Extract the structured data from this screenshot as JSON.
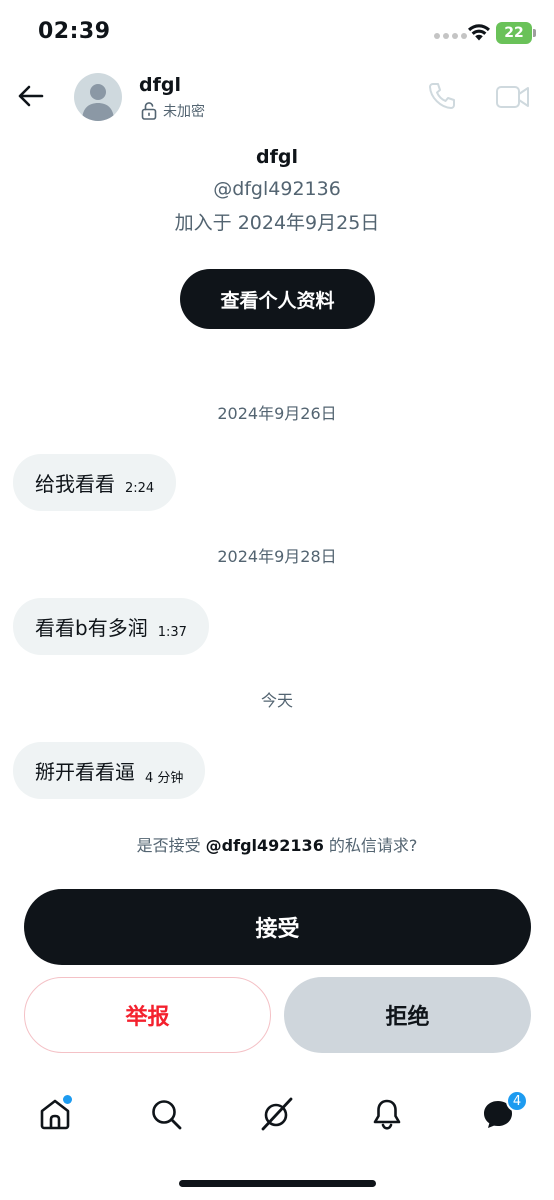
{
  "status_bar": {
    "time": "02:39",
    "battery": "22"
  },
  "header": {
    "name": "dfgl",
    "encryption": "未加密",
    "icons": {
      "back": "arrow-left-icon",
      "lock": "unlock-icon",
      "call": "phone-icon",
      "video": "video-icon"
    }
  },
  "profile": {
    "name": "dfgl",
    "handle": "@dfgl492136",
    "joined": "加入于 2024年9月25日",
    "view_profile_label": "查看个人资料"
  },
  "messages": [
    {
      "date": "2024年9月26日",
      "text": "给我看看",
      "time": "2:24"
    },
    {
      "date": "2024年9月28日",
      "text": "看看b有多润",
      "time": "1:37"
    },
    {
      "date": "今天",
      "text": "掰开看看逼",
      "time": "4 分钟"
    }
  ],
  "request": {
    "prefix": "是否接受 ",
    "handle": "@dfgl492136",
    "suffix": " 的私信请求?",
    "accept_label": "接受",
    "report_label": "举报",
    "decline_label": "拒绝"
  },
  "nav": {
    "messages_badge": "4",
    "icons": [
      "home-icon",
      "search-icon",
      "grok-icon",
      "bell-icon",
      "messages-icon"
    ]
  },
  "colors": {
    "accent": "#1d9bf0",
    "danger": "#f4212e",
    "primary": "#0f1419",
    "muted": "#536471"
  }
}
